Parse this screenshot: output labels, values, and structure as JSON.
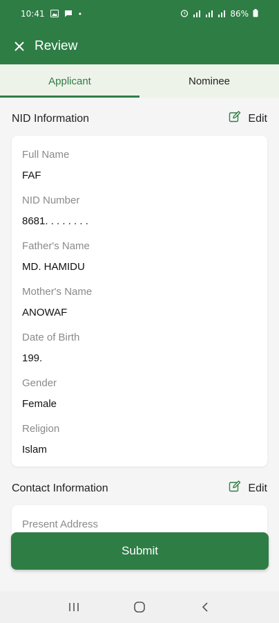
{
  "status_bar": {
    "time": "10:41",
    "battery": "86%",
    "left_icons": [
      "photo-icon",
      "message-icon",
      "dot-icon"
    ],
    "right_icons": [
      "alarm-icon",
      "signal-icon",
      "signal-icon",
      "signal-icon",
      "battery-icon"
    ]
  },
  "header": {
    "title": "Review",
    "close_icon": "close-icon"
  },
  "tabs": [
    {
      "label": "Applicant",
      "active": true
    },
    {
      "label": "Nominee",
      "active": false
    }
  ],
  "nid_section": {
    "title": "NID Information",
    "edit_label": "Edit",
    "fields": [
      {
        "label": "Full Name",
        "value": "FAF"
      },
      {
        "label": "NID Number",
        "value": "8681. . . . . . . ."
      },
      {
        "label": "Father's Name",
        "value": "MD. HAMIDU"
      },
      {
        "label": "Mother's Name",
        "value": "ANOWAF"
      },
      {
        "label": "Date of Birth",
        "value": "199."
      },
      {
        "label": "Gender",
        "value": "Female"
      },
      {
        "label": "Religion",
        "value": "Islam"
      }
    ]
  },
  "contact_section": {
    "title": "Contact Information",
    "edit_label": "Edit",
    "fields": [
      {
        "label": "Present Address",
        "value": ""
      }
    ]
  },
  "submit_label": "Submit",
  "colors": {
    "primary": "#2e7d45",
    "tab_bg": "#eef3ea",
    "page_bg": "#f5f5f5"
  }
}
